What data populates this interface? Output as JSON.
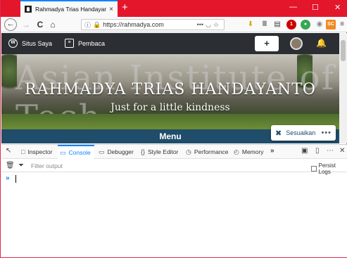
{
  "browser": {
    "tab_title": "Rahmadya Trias Handayanto |",
    "tab_close": "×",
    "new_tab": "+",
    "window": {
      "minimize": "—",
      "maximize": "☐",
      "close": "✕"
    },
    "url": "https://rahmadya.com",
    "nav": {
      "back": "←",
      "forward": "→",
      "reload": "C",
      "home": "⌂"
    },
    "toolbar_badges": {
      "addon_red_count": "1",
      "green_addon": "●",
      "orange_addon": "SC"
    }
  },
  "wp_toolbar": {
    "my_sites": "Situs Saya",
    "reader": "Pembaca",
    "write_icon": "+",
    "notifications_icon": "bell-icon"
  },
  "site": {
    "title": "RAHMADYA TRIAS HANDAYANTO",
    "tagline": "Just for a little kindness",
    "menu_label": "Menu",
    "background_sign_text": "Asian Institute of Tech",
    "customize_label": "Sesuaikan",
    "customize_more": "•••"
  },
  "devtools": {
    "tabs": [
      {
        "label": "Inspector",
        "icon": "□"
      },
      {
        "label": "Console",
        "icon": "▭"
      },
      {
        "label": "Debugger",
        "icon": "▭"
      },
      {
        "label": "Style Editor",
        "icon": "{}"
      },
      {
        "label": "Performance",
        "icon": "◷"
      },
      {
        "label": "Memory",
        "icon": "◴"
      }
    ],
    "more_tabs": "»",
    "active_tab": "Console",
    "filter_placeholder": "Filter output",
    "persist_logs": "Persist Logs",
    "prompt": "»",
    "pick_icon": "↖"
  },
  "colors": {
    "title_bar": "#e4162b",
    "wp_bar": "#2b2f33",
    "menu_bar": "#1f4d6b",
    "accent": "#0a84ff"
  }
}
